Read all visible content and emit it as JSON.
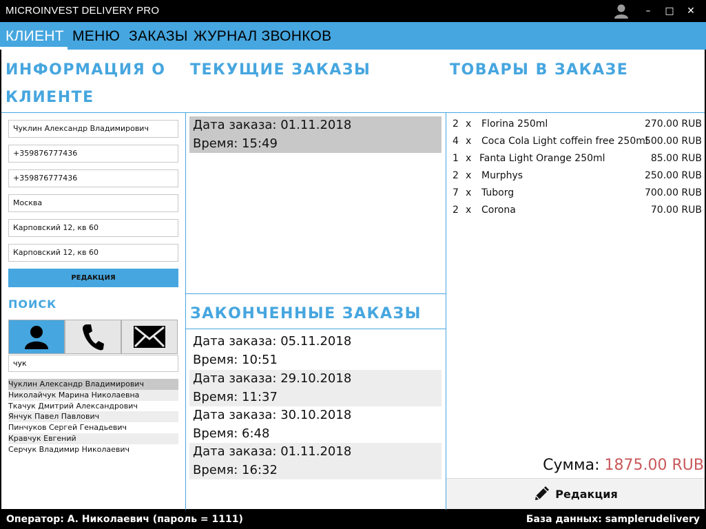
{
  "window": {
    "title": "MICROINVEST DELIVERY PRO",
    "user_icon": "user-icon",
    "minimize": "–",
    "maximize": "□",
    "close": "✕"
  },
  "menu": {
    "items": [
      "КЛИЕНТ",
      "МЕНЮ",
      "ЗАКАЗЫ",
      "ЖУРНАЛ ЗВОНКОВ"
    ],
    "active_index": 0
  },
  "client": {
    "title_line1": "ИНФОРМАЦИЯ О",
    "title_line2": "КЛИЕНТЕ",
    "fields": [
      "Чуклин Александр Владимирович",
      "+359876777436",
      "+359876777436",
      "Москва",
      "Карповский 12, кв 60",
      "Карповский 12, кв 60"
    ],
    "edit_label": "РЕДАКЦИЯ"
  },
  "search": {
    "title": "ПОИСК",
    "tabs": [
      "person-icon",
      "phone-icon",
      "mail-icon"
    ],
    "active_tab": 0,
    "query": "чук",
    "results": [
      "Чуклин Александр Владимирович",
      "Николайчук Марина Николаевна",
      "Ткачук Дмитрий Александрович",
      "Янчук Павел Павлович",
      "Пинчуков Сергей Генадьевич",
      "Кравчук Евгений",
      "Серчук Владимир Николаевич"
    ],
    "selected_index": 0
  },
  "current_orders": {
    "title": "ТЕКУЩИЕ ЗАКАЗЫ",
    "orders": [
      {
        "date": "Дата заказа: 01.11.2018",
        "time": "Время: 15:49"
      }
    ]
  },
  "finished_orders": {
    "title": "ЗАКОНЧЕННЫЕ ЗАКАЗЫ",
    "orders": [
      {
        "date": "Дата заказа: 05.11.2018",
        "time": "Время: 10:51"
      },
      {
        "date": "Дата заказа: 29.10.2018",
        "time": "Время: 11:37"
      },
      {
        "date": "Дата заказа: 30.10.2018",
        "time": "Время: 6:48"
      },
      {
        "date": "Дата заказа: 01.11.2018",
        "time": "Время: 16:32"
      }
    ]
  },
  "order_items": {
    "title": "ТОВАРЫ В ЗАКАЗЕ",
    "items": [
      {
        "qty": "2",
        "x": "x",
        "name": "Florina 250ml",
        "price": "270.00 RUB"
      },
      {
        "qty": "4",
        "x": "x",
        "name": "Coca Cola Light coffein free 250ml",
        "price": "500.00 RUB"
      },
      {
        "qty": "1",
        "x": "x",
        "name": "Fanta Light Orange 250ml",
        "price": "85.00 RUB"
      },
      {
        "qty": "2",
        "x": "x",
        "name": "Murphys",
        "price": "250.00 RUB"
      },
      {
        "qty": "7",
        "x": "x",
        "name": "Tuborg",
        "price": "700.00 RUB"
      },
      {
        "qty": "2",
        "x": "x",
        "name": "Corona",
        "price": "70.00 RUB"
      }
    ],
    "total_label": "Сумма:",
    "total_value": "1875.00 RUB",
    "edit_label": "Редакция",
    "edit_icon": "pencil-icon"
  },
  "status": {
    "operator": "Оператор: А. Николаевич (пароль = 1111)",
    "database": "База данных: samplerudelivery"
  },
  "colors": {
    "accent": "#46a6df",
    "total": "#c9585a",
    "selected_row": "#c8c8c8",
    "alt_row": "#ededed"
  }
}
